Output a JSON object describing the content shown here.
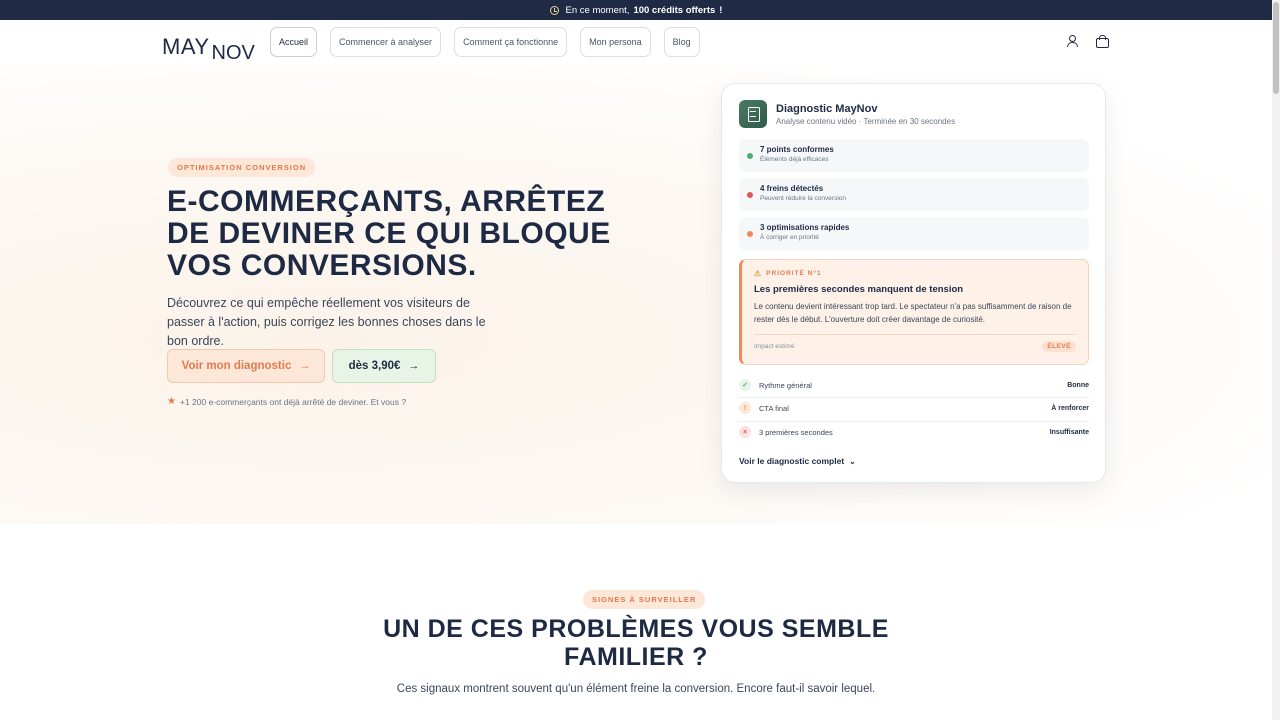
{
  "banner": {
    "prefix": "En ce moment,",
    "highlight": "100 crédits offerts",
    "suffix": "!"
  },
  "logo": {
    "part1": "MAY",
    "part2": "NOV"
  },
  "nav": {
    "links": [
      "Accueil",
      "Commencer à analyser",
      "Comment ça fonctionne",
      "Mon persona",
      "Blog"
    ],
    "active": "Accueil"
  },
  "hero": {
    "pill": "OPTIMISATION CONVERSION",
    "title": "E-COMMERÇANTS, ARRÊTEZ DE DEVINER CE QUI BLOQUE VOS CONVERSIONS.",
    "subtitle": "Découvrez ce qui empêche réellement vos visiteurs de passer à l'action, puis corrigez les bonnes choses dans le bon ordre.",
    "primary_cta": "Voir mon diagnostic",
    "secondary_cta": "dès 3,90€",
    "proof": "+1 200 e-commerçants ont déjà arrêté de deviner. Et vous ?"
  },
  "card": {
    "title": "Diagnostic MayNov",
    "meta": "Analyse contenu vidéo · Terminée en 30 secondes",
    "stats": [
      {
        "title": "7 points conformes",
        "sub": "Éléments déjà efficaces",
        "color": "#4caf6e"
      },
      {
        "title": "4 freins détectés",
        "sub": "Peuvent réduire la conversion",
        "color": "#e05555"
      },
      {
        "title": "3 optimisations rapides",
        "sub": "À corriger en priorité",
        "color": "#ec8a5a"
      }
    ],
    "priority": {
      "tag": "PRIORITÉ N°1",
      "title": "Les premières secondes manquent de tension",
      "desc": "Le contenu devient intéressant trop tard. Le spectateur n'a pas suffisamment de raison de rester dès le début. L'ouverture doit créer davantage de curiosité.",
      "impact_label": "Impact estimé",
      "impact_value": "ÉLEVÉ"
    },
    "metrics": [
      {
        "label": "Rythme général",
        "value": "Bonne",
        "icon": "✓",
        "color": "#4caf6e",
        "bg": "#e6f4ea"
      },
      {
        "label": "CTA final",
        "value": "À renforcer",
        "icon": "!",
        "color": "#ec8a5a",
        "bg": "#fde7d8"
      },
      {
        "label": "3 premières secondes",
        "value": "Insuffisante",
        "icon": "×",
        "color": "#e05555",
        "bg": "#fbe3e3"
      }
    ],
    "more": "Voir le diagnostic complet"
  },
  "section2": {
    "pill": "SIGNES À SURVEILLER",
    "title": "UN DE CES PROBLÈMES VOUS SEMBLE FAMILIER ?",
    "subtitle": "Ces signaux montrent souvent qu'un élément freine la conversion. Encore faut-il savoir lequel."
  }
}
